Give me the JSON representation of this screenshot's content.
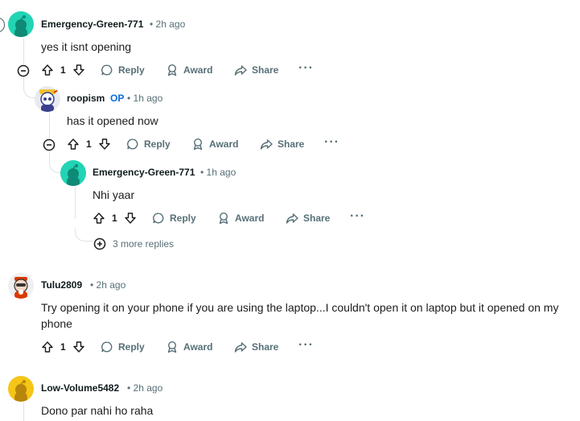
{
  "comments": [
    {
      "user": "Emergency-Green-771",
      "op": "",
      "time": "• 2h ago",
      "text": "yes it isnt opening",
      "score": "1"
    },
    {
      "user": "roopism",
      "op": "OP",
      "time": "• 1h ago",
      "text": "has it opened now",
      "score": "1"
    },
    {
      "user": "Emergency-Green-771",
      "op": "",
      "time": "• 1h ago",
      "text": "Nhi yaar",
      "score": "1"
    },
    {
      "user": "Tulu2809",
      "op": "",
      "time": "• 2h ago",
      "text": "Try opening it on your phone if you are using the laptop...I couldn't open it on laptop but it opened on my phone",
      "score": "1"
    },
    {
      "user": "Low-Volume5482",
      "op": "",
      "time": "• 2h ago",
      "text": "Dono par nahi ho raha",
      "score": ""
    }
  ],
  "actions": {
    "reply": "Reply",
    "award": "Award",
    "share": "Share",
    "more": "···"
  },
  "more_replies": "3 more replies",
  "colors": {
    "accent_op": "#0a6bd8",
    "meta": "#576f76",
    "avatar_teal": "#22d4b4",
    "avatar_yellow": "#f5c518"
  }
}
